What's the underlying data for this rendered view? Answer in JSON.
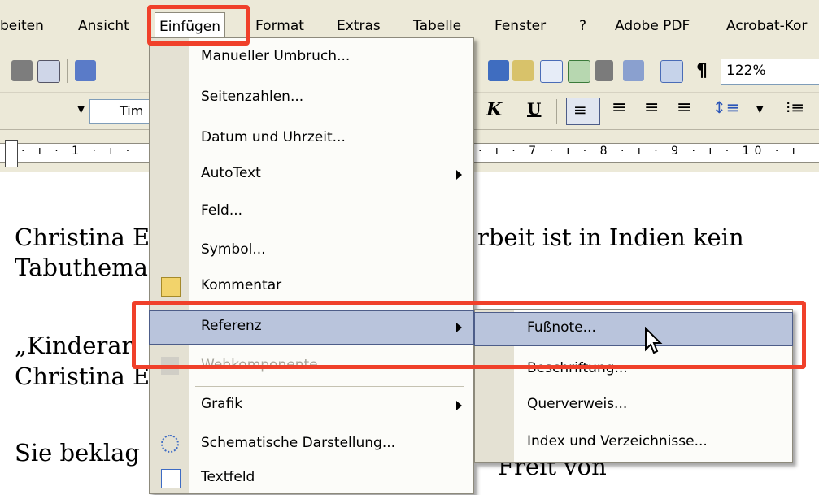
{
  "menubar": {
    "items": [
      {
        "label": "beiten"
      },
      {
        "label": "Ansicht"
      },
      {
        "label": "Einfügen"
      },
      {
        "label": "Format"
      },
      {
        "label": "Extras"
      },
      {
        "label": "Tabelle"
      },
      {
        "label": "Fenster"
      },
      {
        "label": "?"
      },
      {
        "label": "Adobe PDF"
      },
      {
        "label": "Acrobat-Kor"
      }
    ]
  },
  "toolbar": {
    "zoom": "122%",
    "font_name": "Tim",
    "pilcrow": "¶",
    "italic": "K",
    "underline": "U"
  },
  "ruler": {
    "left_numbers": "· ı · 1 · ı ·",
    "right_numbers": "· ı · 7 · ı · 8 · ı · 9 · ı · 10 · ı"
  },
  "document": {
    "lines": [
      "Christina E",
      "Tabuthema",
      "rbeit ist in Indien kein",
      "„Kinderar",
      "Christina E",
      "Sie beklag",
      "Freit von"
    ]
  },
  "insert_menu": {
    "items": [
      {
        "label": "Manueller Umbruch..."
      },
      {
        "label": "Seitenzahlen..."
      },
      {
        "label": "Datum und Uhrzeit..."
      },
      {
        "label": "AutoText"
      },
      {
        "label": "Feld..."
      },
      {
        "label": "Symbol..."
      },
      {
        "label": "Kommentar"
      },
      {
        "label": "Referenz"
      },
      {
        "label": "Webkomponente..."
      },
      {
        "label": "Grafik"
      },
      {
        "label": "Schematische Darstellung..."
      },
      {
        "label": "Textfeld"
      }
    ]
  },
  "reference_submenu": {
    "items": [
      {
        "label": "Fußnote..."
      },
      {
        "label": "Beschriftung..."
      },
      {
        "label": "Querverweis..."
      },
      {
        "label": "Index und Verzeichnisse..."
      }
    ]
  },
  "colors": {
    "annotation_red": "#f0402a",
    "highlight": "#b9c4dc",
    "menu_bg": "#ece9d8"
  }
}
